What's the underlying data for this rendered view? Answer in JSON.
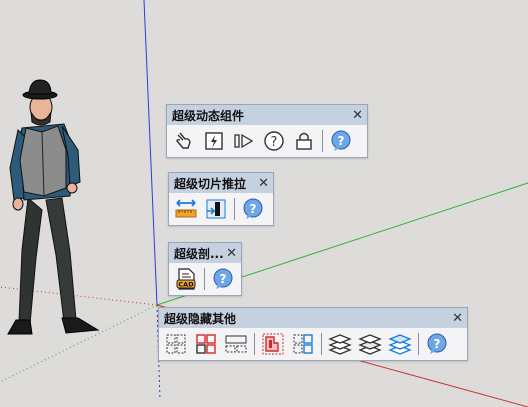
{
  "toolbars": [
    {
      "id": "dynamic",
      "title": "超级动态组件",
      "close": "✕",
      "buttons": [
        "hand-interact-icon",
        "flash-panel-icon",
        "play-forward-icon",
        "help-circle-icon",
        "lock-icon",
        "help-bubble-icon"
      ]
    },
    {
      "id": "slice",
      "title": "超级切片推拉",
      "close": "✕",
      "buttons": [
        "ruler-arrows-icon",
        "push-pull-slice-icon",
        "help-bubble-icon"
      ]
    },
    {
      "id": "section",
      "title": "超级剖...",
      "close": "✕",
      "buttons": [
        "cad-file-icon",
        "help-bubble-icon"
      ]
    },
    {
      "id": "hide",
      "title": "超级隐藏其他",
      "close": "✕",
      "buttons": [
        "grid-dashed-icon",
        "grid-red-icon",
        "grid-split-icon",
        "hide-red-icon",
        "hide-grid-icon",
        "layers-icon",
        "layers-icon",
        "layers-blue-icon",
        "help-bubble-icon"
      ]
    }
  ],
  "colors": {
    "background": "#dddcda",
    "toolbar_header": "#c6d1e0",
    "axis_blue": "#2d3bd8",
    "axis_green": "#2fb32f",
    "axis_red": "#c83030"
  }
}
